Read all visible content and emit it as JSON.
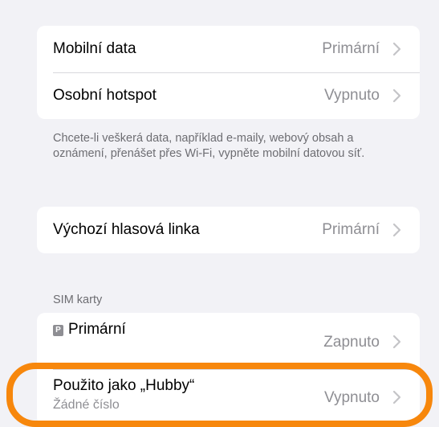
{
  "cellular_group": {
    "mobile_data": {
      "title": "Mobilní data",
      "value": "Primární"
    },
    "personal_hotspot": {
      "title": "Osobní hotspot",
      "value": "Vypnuto"
    }
  },
  "cellular_footer": "Chcete-li veškerá data, například e-maily, webový obsah a oznámení, přenášet přes Wi-Fi, vypněte mobilní datovou síť.",
  "voice_group": {
    "default_voice_line": {
      "title": "Výchozí hlasová linka",
      "value": "Primární"
    }
  },
  "sim_section": {
    "header": "SIM karty",
    "primary": {
      "badge": "P",
      "title": "Primární",
      "value": "Zapnuto"
    },
    "hubby": {
      "title": "Použito jako „Hubby“",
      "subtitle": "Žádné číslo",
      "value": "Vypnuto"
    }
  },
  "highlight_color": "#f7870c",
  "icons": {
    "chevron": "chevron-right-icon"
  }
}
